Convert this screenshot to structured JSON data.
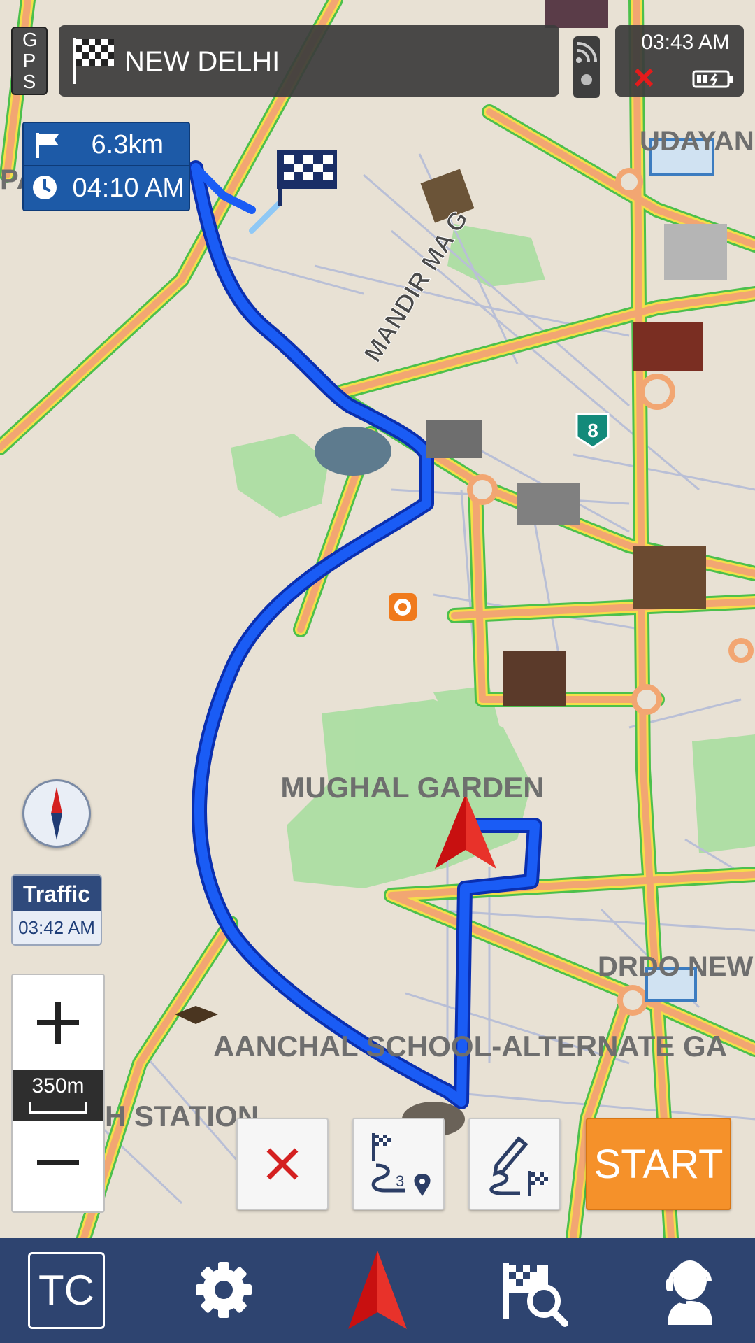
{
  "status_bar": {
    "gps_label": "GPS",
    "destination": "NEW DELHI",
    "time": "03:43 AM"
  },
  "route_info": {
    "distance": "6.3km",
    "eta": "04:10 AM"
  },
  "map": {
    "labels": {
      "road_mandir_marg": "MANDIR MA G",
      "mughal_garden": "MUGHAL GARDEN",
      "drdo": "DRDO NEW",
      "aanchal_school": "AANCHAL SCHOOL-ALTERNATE GA",
      "station": "H STATION",
      "udayan": "UDAYAN",
      "pa": "PA",
      "highway_shield": "8"
    }
  },
  "traffic": {
    "label": "Traffic",
    "time": "03:42 AM"
  },
  "zoom": {
    "scale": "350m"
  },
  "actions": {
    "start_label": "START"
  },
  "navbar": {
    "tc_label": "TC"
  },
  "colors": {
    "route": "#1447e6",
    "navbar": "#2e4470",
    "start": "#f5912a",
    "road_major": "#f4a974",
    "road_border": "#f6e04a",
    "park": "#9fdc9a"
  },
  "icons": [
    "gps-icon",
    "checkered-flag-icon",
    "signal-icon",
    "close-icon",
    "battery-icon",
    "flag-icon",
    "clock-icon",
    "compass-icon",
    "plus-icon",
    "minus-icon",
    "route-overview-icon",
    "edit-route-icon",
    "settings-icon",
    "navigation-arrow-icon",
    "search-destination-icon",
    "support-icon"
  ]
}
